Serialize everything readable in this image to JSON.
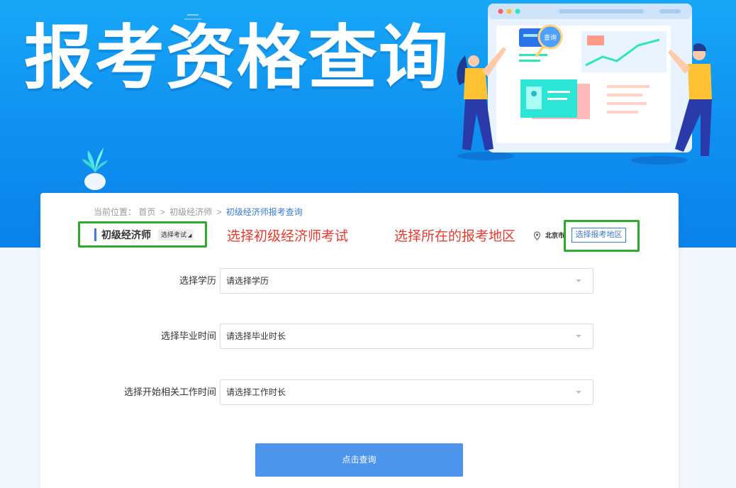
{
  "banner": {
    "title": "报考资格查询",
    "illustration_label": "查询"
  },
  "breadcrumb": {
    "prefix": "当前位置：",
    "items": [
      "首页",
      "初级经济师",
      "初级经济师报考查询"
    ],
    "separator": ">"
  },
  "exam": {
    "title": "初级经济师",
    "select_label": "选择考试"
  },
  "annotations": {
    "choose_exam": "选择初级经济师考试",
    "choose_region": "选择所在的报考地区"
  },
  "location": {
    "icon": "location-pin-icon",
    "city": "北京市",
    "button_label": "选择报考地区"
  },
  "form": {
    "fields": [
      {
        "label": "选择学历",
        "placeholder": "请选择学历"
      },
      {
        "label": "选择毕业时间",
        "placeholder": "请选择毕业时长"
      },
      {
        "label": "选择开始相关工作时间",
        "placeholder": "请选择工作时长"
      }
    ],
    "submit_label": "点击查询"
  },
  "colors": {
    "banner_blue": "#0f8ff0",
    "accent_blue": "#3a7bd5",
    "button_blue": "#4c94ec",
    "annotation_red": "#e83a2f",
    "highlight_green": "#2eaa2e"
  }
}
